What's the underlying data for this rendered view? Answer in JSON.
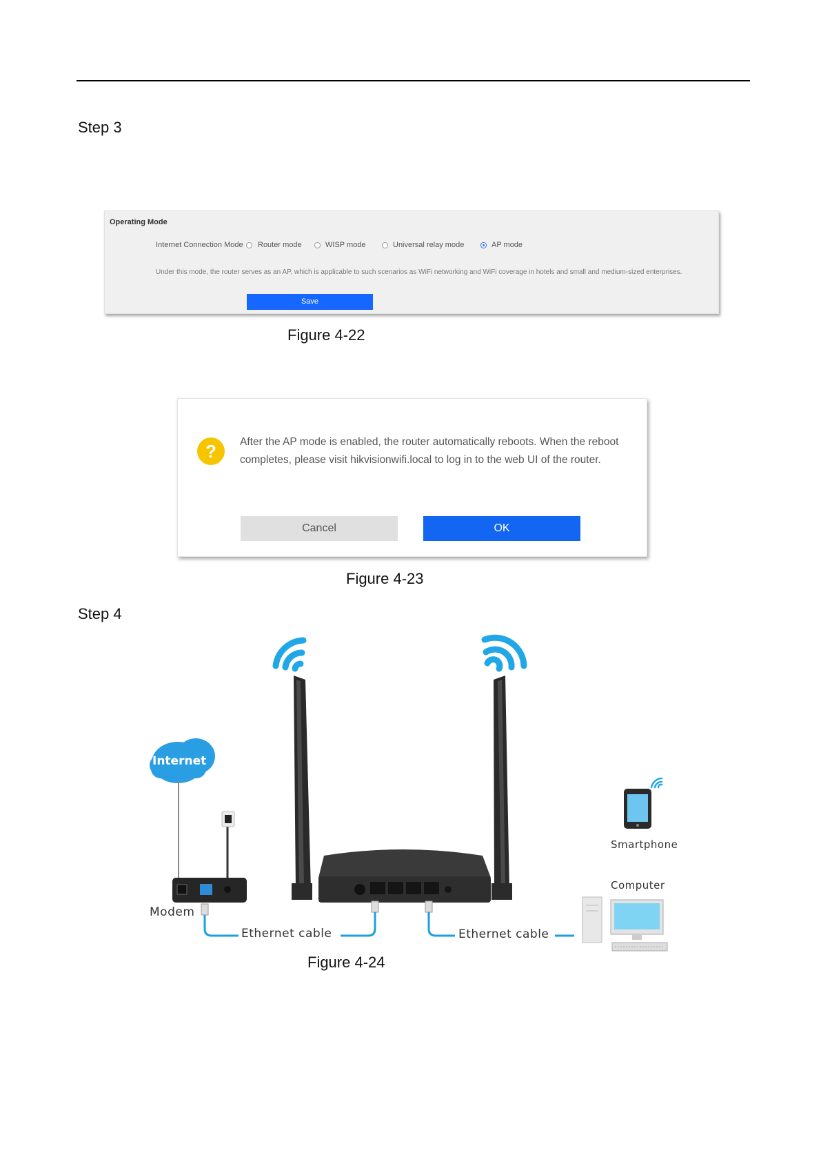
{
  "steps": {
    "step3": "Step 3",
    "step4": "Step 4"
  },
  "figure22": {
    "title": "Operating Mode",
    "label": "Internet Connection Mode",
    "options": [
      "Router mode",
      "WISP mode",
      "Universal relay mode",
      "AP mode"
    ],
    "selected_option": "AP mode",
    "description": "Under this mode, the router serves as an AP, which is applicable to such scenarios as WiFi networking and WiFi coverage in hotels and small and medium-sized enterprises.",
    "save_label": "Save",
    "caption": "Figure 4-22"
  },
  "figure23": {
    "icon": "question-icon",
    "message": "After the AP mode is enabled, the router automatically reboots. When the reboot completes, please visit hikvisionwifi.local to log in to the web UI of the router.",
    "cancel_label": "Cancel",
    "ok_label": "OK",
    "caption": "Figure 4-23"
  },
  "figure24": {
    "internet_label": "Internet",
    "modem_label": "Modem",
    "cable_label_left": "Ethernet cable",
    "cable_label_right": "Ethernet cable",
    "smartphone_label": "Smartphone",
    "computer_label": "Computer",
    "caption": "Figure 4-24"
  },
  "colors": {
    "accent_blue": "#1266f1",
    "cable_blue": "#1aa0e0",
    "wifi_blue": "#22a7e6",
    "warning_yellow": "#f7c500"
  }
}
